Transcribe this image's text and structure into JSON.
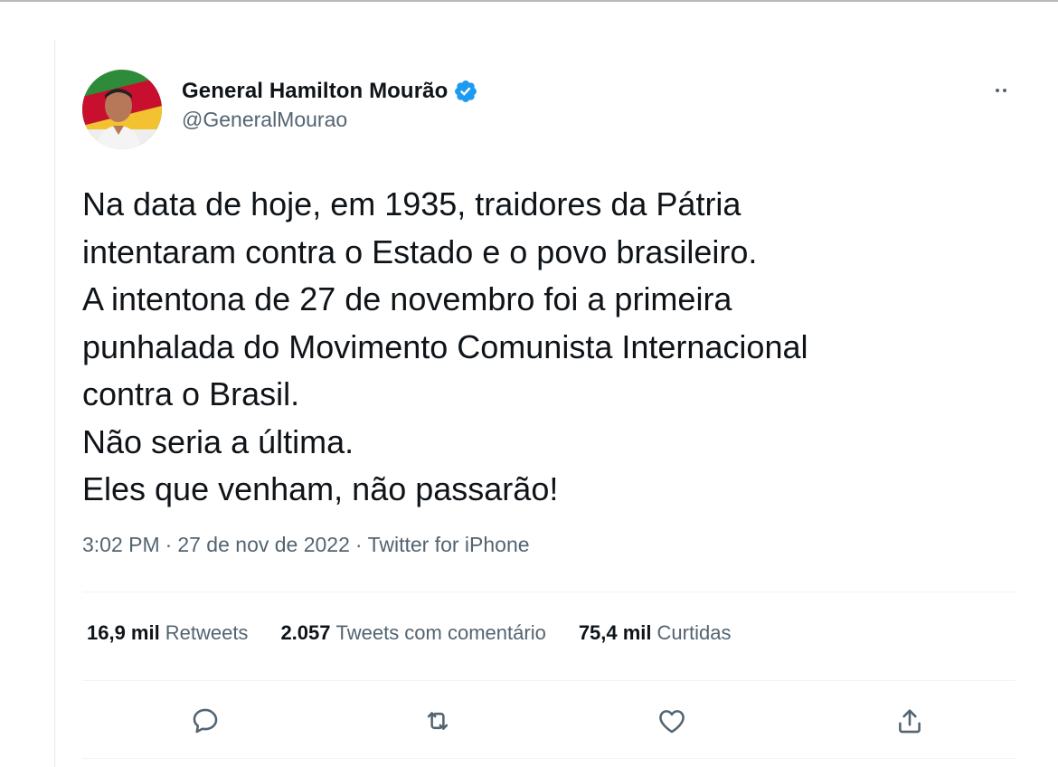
{
  "tweet": {
    "author": {
      "display_name": "General Hamilton Mourão",
      "handle": "@GeneralMourao",
      "verified": true
    },
    "text_lines": [
      "Na data de hoje, em 1935, traidores da Pátria",
      "intentaram contra o Estado e o povo brasileiro.",
      "A intentona de 27 de novembro foi a primeira",
      "punhalada do Movimento Comunista Internacional",
      "contra o Brasil.",
      "Não seria a última.",
      "Eles que venham, não passarão!"
    ],
    "meta": {
      "time": "3:02 PM",
      "separator": "·",
      "date": "27 de nov de 2022",
      "source": "Twitter for iPhone"
    },
    "stats": {
      "retweets": {
        "count": "16,9 mil",
        "label": "Retweets"
      },
      "quotes": {
        "count": "2.057",
        "label": "Tweets com comentário"
      },
      "likes": {
        "count": "75,4 mil",
        "label": "Curtidas"
      }
    },
    "actions": [
      "reply-icon",
      "retweet-icon",
      "like-icon",
      "share-icon"
    ]
  },
  "colors": {
    "text_primary": "#0f1419",
    "text_secondary": "#536471",
    "verified_blue": "#1d9bf0",
    "divider": "#eff3f4"
  }
}
